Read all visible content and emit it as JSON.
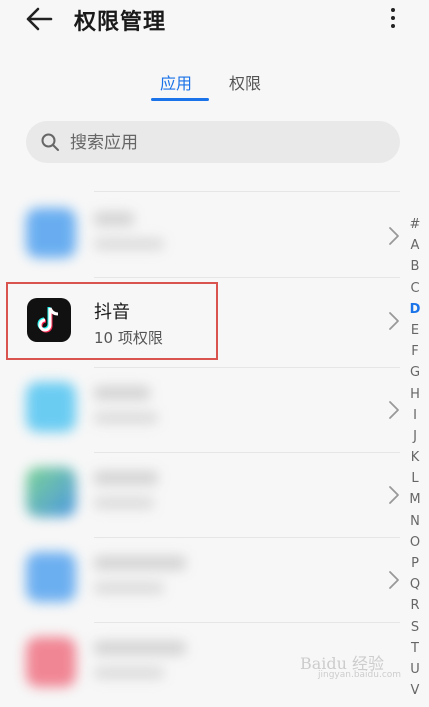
{
  "header": {
    "title": "权限管理"
  },
  "tabs": [
    {
      "label": "应用"
    },
    {
      "label": "权限"
    }
  ],
  "search": {
    "placeholder": "搜索应用"
  },
  "apps": [
    {
      "name": "抖音",
      "permissions": "10 项权限"
    }
  ],
  "colors": {
    "accent": "#1a73e8",
    "highlight_box": "#d9534f"
  },
  "index": [
    "#",
    "A",
    "B",
    "C",
    "D",
    "E",
    "F",
    "G",
    "H",
    "I",
    "J",
    "K",
    "L",
    "M",
    "N",
    "O",
    "P",
    "Q",
    "R",
    "S",
    "T",
    "U",
    "V"
  ],
  "index_active": "D",
  "watermark": {
    "text": "Baidu 经验",
    "sub": "jingyan.baidu.com"
  }
}
